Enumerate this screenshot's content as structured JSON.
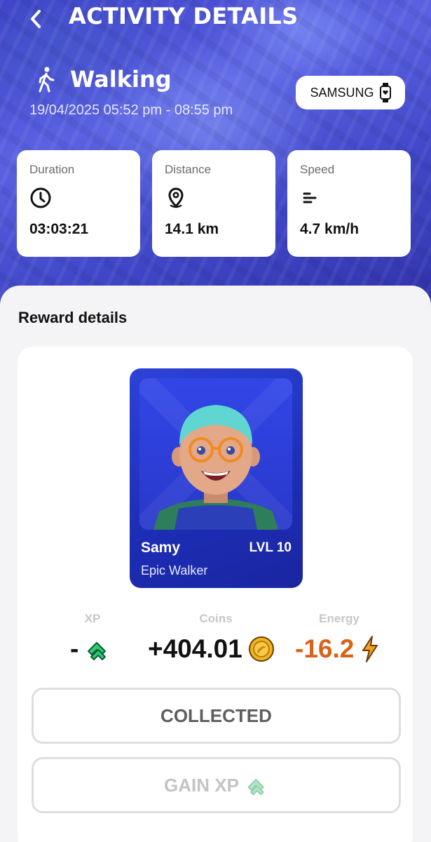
{
  "header": {
    "title": "ACTIVITY DETAILS",
    "back_icon": "chevron-left-icon"
  },
  "activity": {
    "name": "Walking",
    "icon": "walking-person-icon",
    "time_range": "19/04/2025 05:52 pm - 08:55 pm",
    "device": "SAMSUNG",
    "device_icon": "smartwatch-icon"
  },
  "stats": [
    {
      "label": "Duration",
      "value": "03:03:21",
      "icon": "clock-icon"
    },
    {
      "label": "Distance",
      "value": "14.1 km",
      "icon": "location-pin-icon"
    },
    {
      "label": "Speed",
      "value": "4.7 km/h",
      "icon": "speed-lines-icon"
    }
  ],
  "reward": {
    "heading": "Reward details",
    "avatar": {
      "name": "Samy",
      "level": "LVL 10",
      "title": "Epic Walker"
    },
    "xp": {
      "label": "XP",
      "value": "-"
    },
    "coins": {
      "label": "Coins",
      "value": "+404.01"
    },
    "energy": {
      "label": "Energy",
      "value": "-16.2"
    }
  },
  "buttons": {
    "collected": "COLLECTED",
    "gain_xp": "GAIN XP"
  },
  "colors": {
    "energy": "#d9621a",
    "xp_green": "#27c86a",
    "coin_gold": "#f2b51c",
    "card_blue": "#2239c9"
  }
}
